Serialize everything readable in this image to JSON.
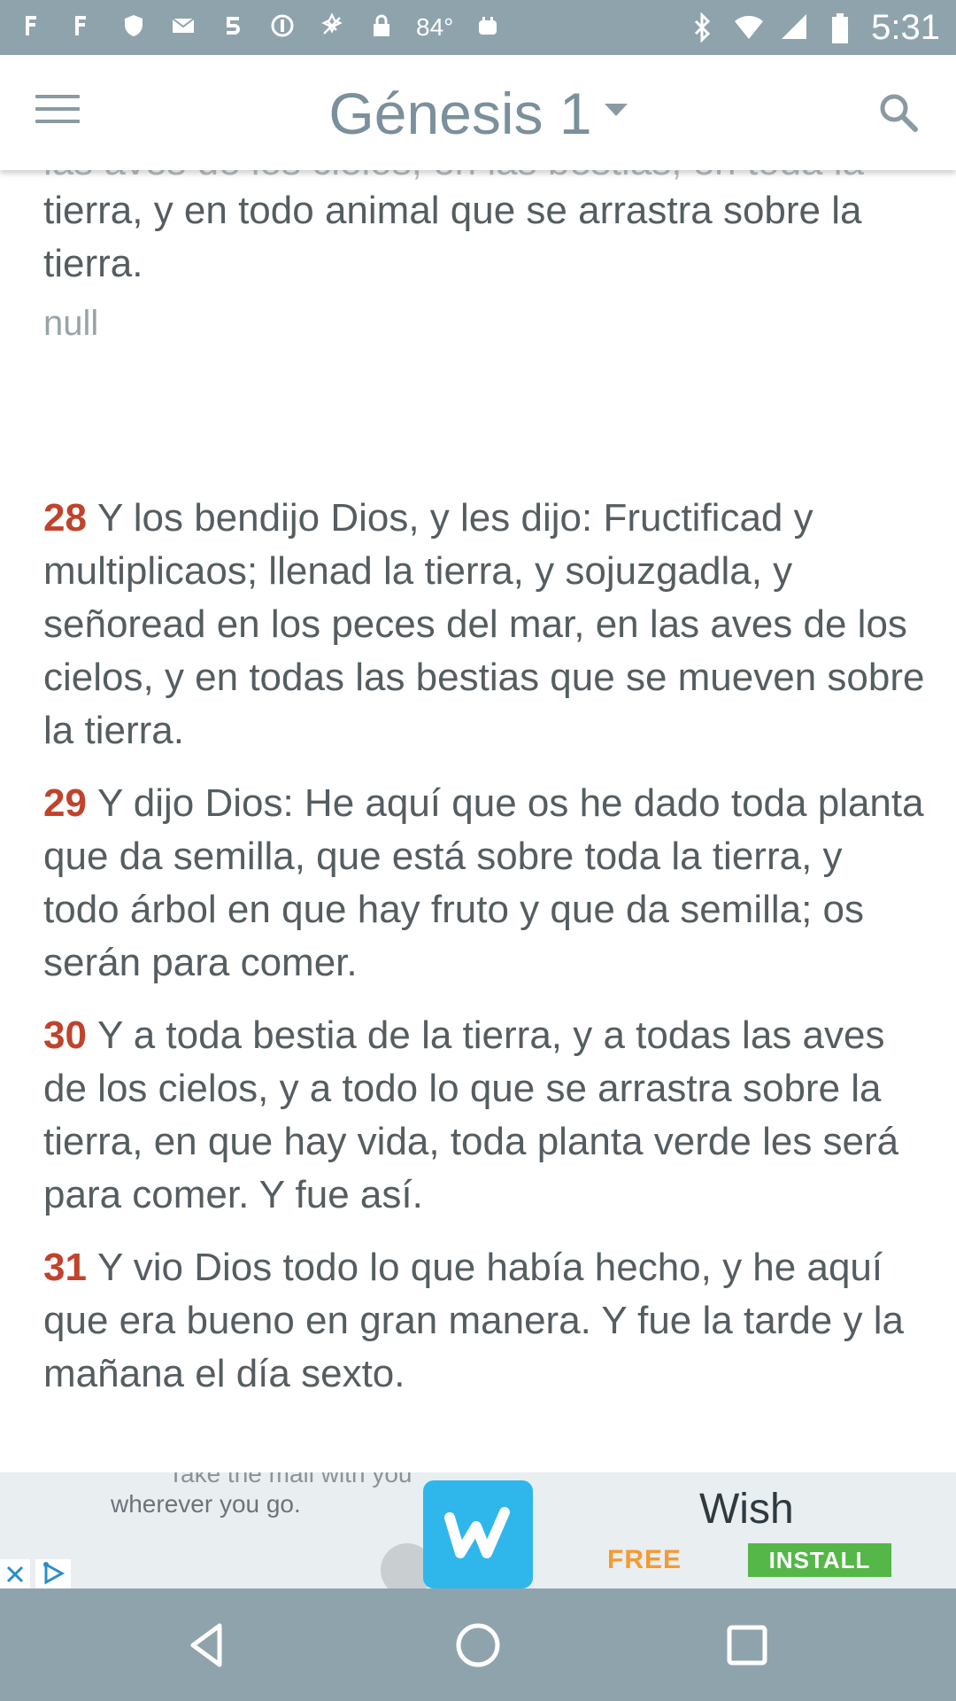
{
  "status_bar": {
    "left_icons": [
      "photos-icon",
      "photos-icon",
      "shield-icon",
      "mail-icon",
      "app-5-icon",
      "circle-info-icon",
      "location-off-icon",
      "lock-icon"
    ],
    "temperature": "84°",
    "right_icons": [
      "bluetooth-icon",
      "wifi-icon",
      "cellular-icon",
      "battery-icon"
    ],
    "time": "5:31"
  },
  "app_bar": {
    "title": "Génesis 1"
  },
  "reader": {
    "partial_top_line": "las aves de los cielos, en las bestias, en toda la",
    "partial_text": "tierra, y en todo animal que se arrastra sobre la tierra.",
    "null_label": "null",
    "verses": [
      {
        "num": "28",
        "text": "Y los bendijo Dios, y les dijo: Fructificad y multiplicaos; llenad la tierra, y sojuzgadla, y señoread en los peces del mar, en las aves de los cielos, y en todas las bestias que se mueven sobre la tierra."
      },
      {
        "num": "29",
        "text": "Y dijo Dios: He aquí que os he dado toda planta que da semilla, que está sobre toda la tierra, y todo árbol en que hay fruto y que da semilla; os serán para comer."
      },
      {
        "num": "30",
        "text": "Y a toda bestia de la tierra, y a todas las aves de los cielos, y a todo lo que se arrastra sobre la tierra, en que hay vida, toda planta verde les será para comer. Y fue así."
      },
      {
        "num": "31",
        "text": "Y vio Dios todo lo que había hecho, y he aquí que era bueno en gran manera. Y fue la tarde y la mañana el día sexto."
      }
    ]
  },
  "ad": {
    "caption_top": "Take the mall with you",
    "caption": "wherever you go.",
    "brand": "Wish",
    "free_label": "FREE",
    "install_label": "INSTALL"
  },
  "colors": {
    "bar_bg": "#8fa3ad",
    "verse_number": "#c0432c",
    "body_text": "#555d61",
    "title": "#7a909c",
    "wish_blue": "#2fb7ec",
    "install_green": "#55b748"
  }
}
